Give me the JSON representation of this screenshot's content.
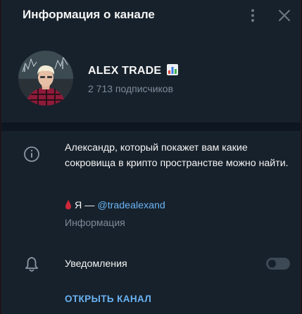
{
  "header": {
    "title": "Информация о канале",
    "menu_icon": "kebab-menu-icon",
    "close_icon": "close-icon"
  },
  "channel": {
    "name": "ALEX TRADE",
    "name_emoji": "bar-chart-emoji",
    "subscribers": "2 713 подписчиков"
  },
  "about": {
    "icon": "info-icon",
    "description": "Александр, который покажет вам какие сокровища в крипто пространстве можно найти.",
    "contact_prefix": "Я — ",
    "contact_link": "@tradealexand",
    "label": "Информация"
  },
  "notifications": {
    "icon": "bell-icon",
    "label": "Уведомления",
    "enabled": false
  },
  "open_button": "ОТКРЫТЬ КАНАЛ",
  "colors": {
    "panel": "#17212b",
    "separator": "#0e1621",
    "text": "#f5f5f5",
    "muted": "#7d8b99",
    "accent": "#6ab3f3"
  }
}
